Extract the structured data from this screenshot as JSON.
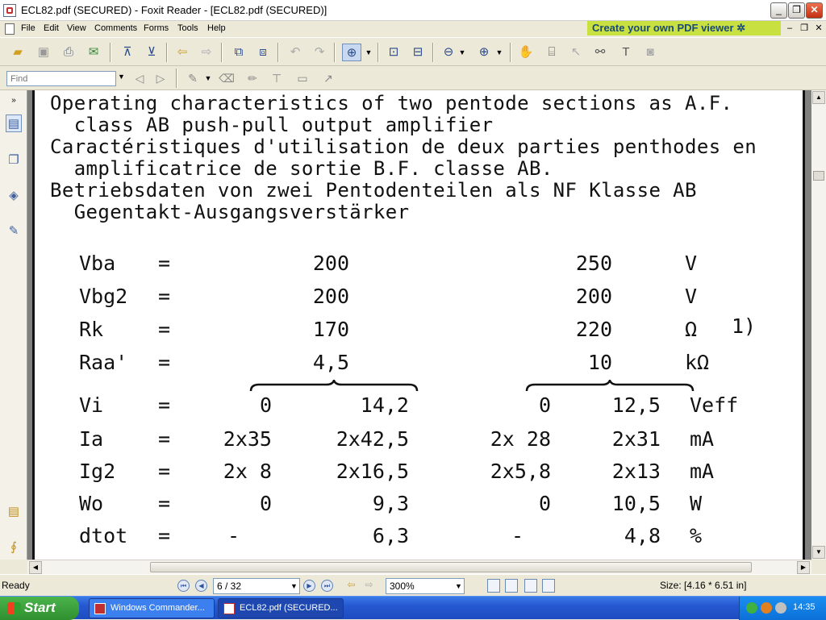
{
  "window": {
    "title": "ECL82.pdf (SECURED) - Foxit Reader - [ECL82.pdf (SECURED)]"
  },
  "menu": [
    "File",
    "Edit",
    "View",
    "Comments",
    "Forms",
    "Tools",
    "Help"
  ],
  "promo": "Create your own PDF viewer",
  "find": {
    "placeholder": "Find"
  },
  "document": {
    "heading_lines": [
      "Operating characteristics of two pentode sections as A.F.",
      "  class AB push-pull output amplifier",
      "Caractéristiques d'utilisation de deux parties penthodes en",
      "  amplificatrice de sortie B.F. classe AB.",
      "Betriebsdaten von zwei Pentodenteilen als NF Klasse AB",
      "  Gegentakt-Ausgangsverstärker"
    ],
    "table_a": [
      {
        "sym": "Vba",
        "eq": "=",
        "left": "200",
        "right": "250",
        "unit": "V",
        "note": ""
      },
      {
        "sym": "Vbg2",
        "eq": "=",
        "left": "200",
        "right": "200",
        "unit": "V",
        "note": ""
      },
      {
        "sym": "Rk",
        "eq": "=",
        "left": "170",
        "right": "220",
        "unit": "Ω",
        "note": "1)"
      },
      {
        "sym": "Raa'",
        "eq": "=",
        "left": "4,5",
        "right": "10",
        "unit": "kΩ",
        "note": ""
      }
    ],
    "table_b": [
      {
        "sym": "Vi",
        "eq": "=",
        "c1": "0",
        "c2": "14,2",
        "c3": "0",
        "c4": "12,5",
        "unit": "Veff"
      },
      {
        "sym": "Ia",
        "eq": "=",
        "c1": "2x35",
        "c2": "2x42,5",
        "c3": "2x 28",
        "c4": "2x31",
        "unit": "mA"
      },
      {
        "sym": "Ig2",
        "eq": "=",
        "c1": "2x 8",
        "c2": "2x16,5",
        "c3": "2x5,8",
        "c4": "2x13",
        "unit": "mA"
      },
      {
        "sym": "Wo",
        "eq": "=",
        "c1": "0",
        "c2": "9,3",
        "c3": "0",
        "c4": "10,5",
        "unit": "W"
      },
      {
        "sym": "dtot",
        "eq": "=",
        "c1": "-",
        "c2": "6,3",
        "c3": "-",
        "c4": "4,8",
        "unit": "%"
      }
    ]
  },
  "status": {
    "ready": "Ready",
    "page": "6 / 32",
    "zoom": "300%",
    "size": "Size: [4.16 * 6.51 in]"
  },
  "taskbar": {
    "start": "Start",
    "tasks": [
      "Windows Commander...",
      "ECL82.pdf (SECURED..."
    ],
    "clock": "14:35"
  }
}
